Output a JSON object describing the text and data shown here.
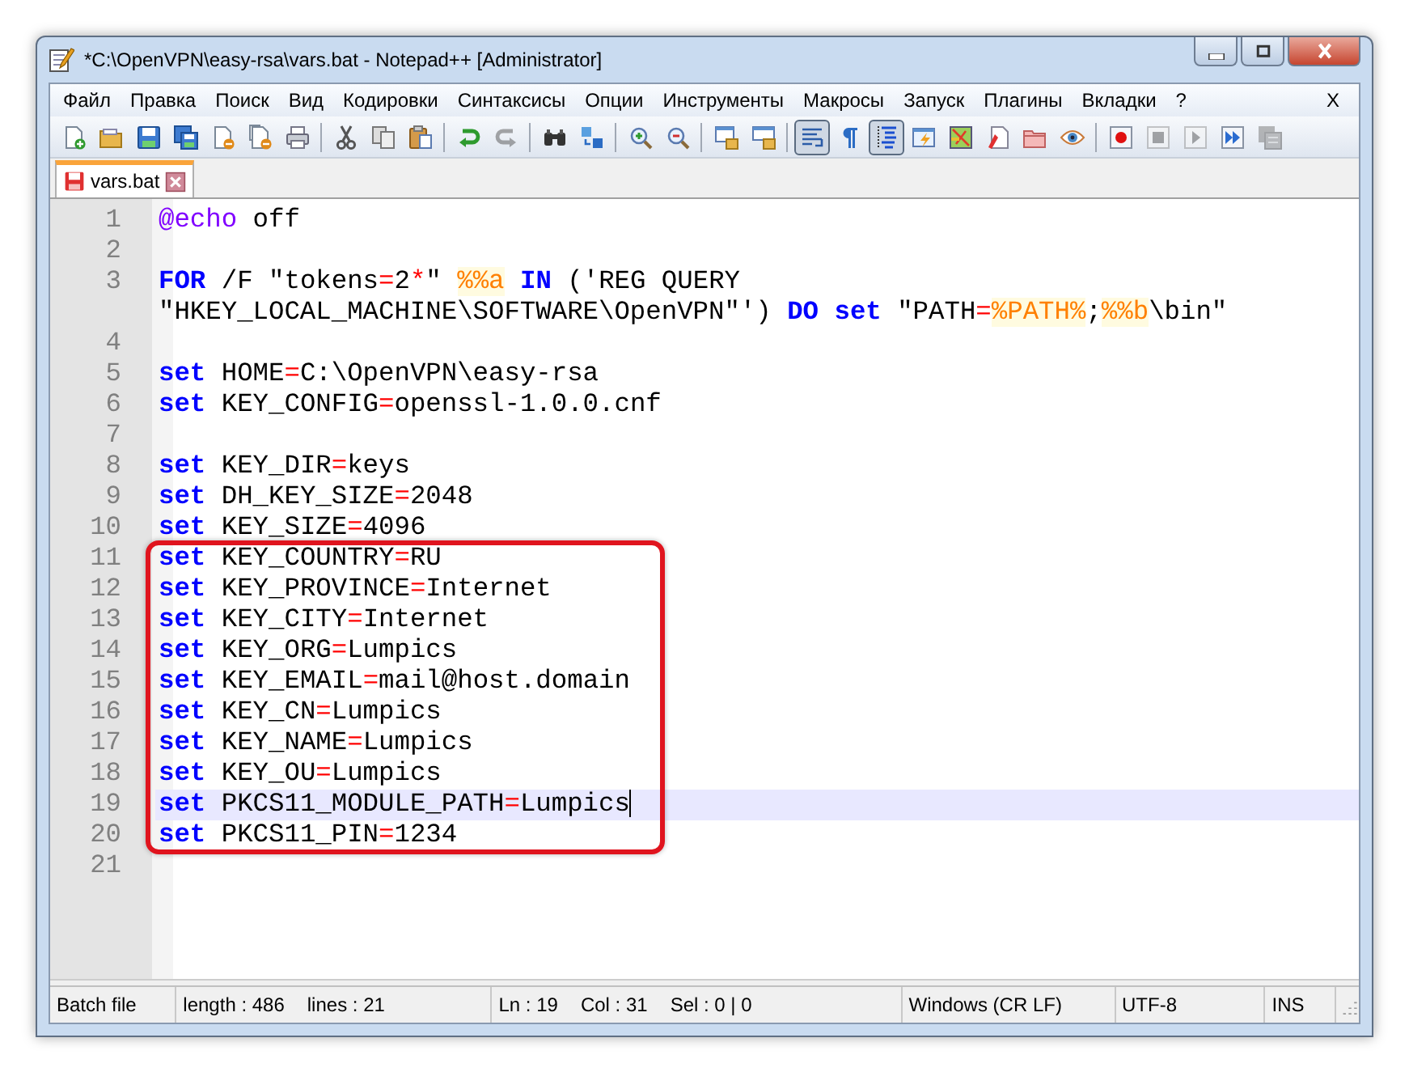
{
  "window": {
    "title": "*C:\\OpenVPN\\easy-rsa\\vars.bat - Notepad++ [Administrator]"
  },
  "menu": {
    "items": [
      "Файл",
      "Правка",
      "Поиск",
      "Вид",
      "Кодировки",
      "Синтаксисы",
      "Опции",
      "Инструменты",
      "Макросы",
      "Запуск",
      "Плагины",
      "Вкладки",
      "?"
    ],
    "close_label": "X"
  },
  "toolbar": [
    [
      {
        "kind": "new",
        "pressed": false,
        "disabled": false
      },
      {
        "kind": "open",
        "pressed": false,
        "disabled": false
      },
      {
        "kind": "save",
        "pressed": false,
        "disabled": false
      },
      {
        "kind": "save-all",
        "pressed": false,
        "disabled": false
      },
      {
        "kind": "close",
        "pressed": false,
        "disabled": false
      },
      {
        "kind": "close-all",
        "pressed": false,
        "disabled": false
      },
      {
        "kind": "print",
        "pressed": false,
        "disabled": false
      }
    ],
    [
      {
        "kind": "cut",
        "pressed": false,
        "disabled": false
      },
      {
        "kind": "copy",
        "pressed": false,
        "disabled": false
      },
      {
        "kind": "paste",
        "pressed": false,
        "disabled": false
      }
    ],
    [
      {
        "kind": "undo",
        "pressed": false,
        "disabled": false
      },
      {
        "kind": "redo",
        "pressed": false,
        "disabled": true
      }
    ],
    [
      {
        "kind": "find",
        "pressed": false,
        "disabled": false
      },
      {
        "kind": "replace",
        "pressed": false,
        "disabled": false
      }
    ],
    [
      {
        "kind": "zoom-in",
        "pressed": false,
        "disabled": false
      },
      {
        "kind": "zoom-out",
        "pressed": false,
        "disabled": false
      }
    ],
    [
      {
        "kind": "sync-v",
        "pressed": false,
        "disabled": false
      },
      {
        "kind": "sync-h",
        "pressed": false,
        "disabled": false
      }
    ],
    [
      {
        "kind": "wrap",
        "pressed": true,
        "disabled": false
      },
      {
        "kind": "show-all",
        "pressed": false,
        "disabled": false
      },
      {
        "kind": "indent-guide",
        "pressed": true,
        "disabled": false
      },
      {
        "kind": "udl",
        "pressed": false,
        "disabled": false
      },
      {
        "kind": "doc-map",
        "pressed": false,
        "disabled": false
      },
      {
        "kind": "func-list",
        "pressed": false,
        "disabled": false
      },
      {
        "kind": "folder",
        "pressed": false,
        "disabled": false
      },
      {
        "kind": "monitor",
        "pressed": false,
        "disabled": false
      }
    ],
    [
      {
        "kind": "record",
        "pressed": false,
        "disabled": false
      },
      {
        "kind": "stop",
        "pressed": false,
        "disabled": true
      },
      {
        "kind": "play",
        "pressed": false,
        "disabled": true
      },
      {
        "kind": "play-multi",
        "pressed": false,
        "disabled": false
      },
      {
        "kind": "save-macro",
        "pressed": false,
        "disabled": true
      }
    ]
  ],
  "tabs": [
    {
      "label": "vars.bat",
      "selected": true,
      "modified": true
    }
  ],
  "editor": {
    "sections": [
      {
        "outlined": false,
        "rows": [
          {
            "number": "1",
            "current": false,
            "tokens": [
              {
                "text": "@echo",
                "kind": "command"
              },
              {
                "text": " off",
                "kind": "text"
              }
            ]
          },
          {
            "number": "2",
            "current": false,
            "tokens": []
          },
          {
            "number": "3",
            "current": false,
            "tokens": [
              {
                "text": "FOR",
                "kind": "keyword"
              },
              {
                "text": " /F \"tokens",
                "kind": "text"
              },
              {
                "text": "=",
                "kind": "operator"
              },
              {
                "text": "2",
                "kind": "text"
              },
              {
                "text": "*",
                "kind": "operator"
              },
              {
                "text": "\" ",
                "kind": "text"
              },
              {
                "text": "%%a",
                "kind": "variable"
              },
              {
                "text": " IN",
                "kind": "keyword"
              },
              {
                "text": " ('REG QUERY",
                "kind": "text"
              }
            ]
          },
          {
            "current": false,
            "tokens": [
              {
                "text": "\"HKEY_LOCAL_MACHINE\\SOFTWARE\\OpenVPN\"') ",
                "kind": "text"
              },
              {
                "text": "DO",
                "kind": "keyword"
              },
              {
                "text": " set",
                "kind": "keyword"
              },
              {
                "text": " \"PATH",
                "kind": "text"
              },
              {
                "text": "=",
                "kind": "operator"
              },
              {
                "text": "%PATH%",
                "kind": "variable"
              },
              {
                "text": ";",
                "kind": "text"
              },
              {
                "text": "%%b",
                "kind": "variable"
              },
              {
                "text": "\\bin\"",
                "kind": "text"
              }
            ]
          },
          {
            "number": "4",
            "current": false,
            "tokens": []
          },
          {
            "number": "5",
            "current": false,
            "tokens": [
              {
                "text": "set",
                "kind": "keyword"
              },
              {
                "text": " HOME",
                "kind": "text"
              },
              {
                "text": "=",
                "kind": "operator"
              },
              {
                "text": "C:\\OpenVPN\\easy-rsa",
                "kind": "text"
              }
            ]
          },
          {
            "number": "6",
            "current": false,
            "tokens": [
              {
                "text": "set",
                "kind": "keyword"
              },
              {
                "text": " KEY_CONFIG",
                "kind": "text"
              },
              {
                "text": "=",
                "kind": "operator"
              },
              {
                "text": "openssl-1.0.0.cnf",
                "kind": "text"
              }
            ]
          },
          {
            "number": "7",
            "current": false,
            "tokens": []
          },
          {
            "number": "8",
            "current": false,
            "tokens": [
              {
                "text": "set",
                "kind": "keyword"
              },
              {
                "text": " KEY_DIR",
                "kind": "text"
              },
              {
                "text": "=",
                "kind": "operator"
              },
              {
                "text": "keys",
                "kind": "text"
              }
            ]
          },
          {
            "number": "9",
            "current": false,
            "tokens": [
              {
                "text": "set",
                "kind": "keyword"
              },
              {
                "text": " DH_KEY_SIZE",
                "kind": "text"
              },
              {
                "text": "=",
                "kind": "operator"
              },
              {
                "text": "2048",
                "kind": "text"
              }
            ]
          },
          {
            "number": "10",
            "current": false,
            "tokens": [
              {
                "text": "set",
                "kind": "keyword"
              },
              {
                "text": " KEY_SIZE",
                "kind": "text"
              },
              {
                "text": "=",
                "kind": "operator"
              },
              {
                "text": "4096",
                "kind": "text"
              }
            ]
          }
        ]
      },
      {
        "outlined": true,
        "rows": [
          {
            "number": "11",
            "current": false,
            "tokens": [
              {
                "text": "set",
                "kind": "keyword"
              },
              {
                "text": " KEY_COUNTRY",
                "kind": "text"
              },
              {
                "text": "=",
                "kind": "operator"
              },
              {
                "text": "RU",
                "kind": "text"
              }
            ]
          },
          {
            "number": "12",
            "current": false,
            "tokens": [
              {
                "text": "set",
                "kind": "keyword"
              },
              {
                "text": " KEY_PROVINCE",
                "kind": "text"
              },
              {
                "text": "=",
                "kind": "operator"
              },
              {
                "text": "Internet",
                "kind": "text"
              }
            ]
          },
          {
            "number": "13",
            "current": false,
            "tokens": [
              {
                "text": "set",
                "kind": "keyword"
              },
              {
                "text": " KEY_CITY",
                "kind": "text"
              },
              {
                "text": "=",
                "kind": "operator"
              },
              {
                "text": "Internet",
                "kind": "text"
              }
            ]
          },
          {
            "number": "14",
            "current": false,
            "tokens": [
              {
                "text": "set",
                "kind": "keyword"
              },
              {
                "text": " KEY_ORG",
                "kind": "text"
              },
              {
                "text": "=",
                "kind": "operator"
              },
              {
                "text": "Lumpics",
                "kind": "text"
              }
            ]
          },
          {
            "number": "15",
            "current": false,
            "tokens": [
              {
                "text": "set",
                "kind": "keyword"
              },
              {
                "text": " KEY_EMAIL",
                "kind": "text"
              },
              {
                "text": "=",
                "kind": "operator"
              },
              {
                "text": "mail@host.domain",
                "kind": "text"
              }
            ]
          },
          {
            "number": "16",
            "current": false,
            "tokens": [
              {
                "text": "set",
                "kind": "keyword"
              },
              {
                "text": " KEY_CN",
                "kind": "text"
              },
              {
                "text": "=",
                "kind": "operator"
              },
              {
                "text": "Lumpics",
                "kind": "text"
              }
            ]
          },
          {
            "number": "17",
            "current": false,
            "tokens": [
              {
                "text": "set",
                "kind": "keyword"
              },
              {
                "text": " KEY_NAME",
                "kind": "text"
              },
              {
                "text": "=",
                "kind": "operator"
              },
              {
                "text": "Lumpics",
                "kind": "text"
              }
            ]
          },
          {
            "number": "18",
            "current": false,
            "tokens": [
              {
                "text": "set",
                "kind": "keyword"
              },
              {
                "text": " KEY_OU",
                "kind": "text"
              },
              {
                "text": "=",
                "kind": "operator"
              },
              {
                "text": "Lumpics",
                "kind": "text"
              }
            ]
          },
          {
            "number": "19",
            "current": true,
            "tokens": [
              {
                "text": "set",
                "kind": "keyword"
              },
              {
                "text": " PKCS11_MODULE_PATH",
                "kind": "text"
              },
              {
                "text": "=",
                "kind": "operator"
              },
              {
                "text": "Lumpics",
                "kind": "text"
              }
            ]
          },
          {
            "number": "20",
            "current": false,
            "tokens": [
              {
                "text": "set",
                "kind": "keyword"
              },
              {
                "text": " PKCS11_PIN",
                "kind": "text"
              },
              {
                "text": "=",
                "kind": "operator"
              },
              {
                "text": "1234",
                "kind": "text"
              }
            ]
          }
        ]
      },
      {
        "outlined": false,
        "rows": [
          {
            "number": "21",
            "current": false,
            "tokens": []
          }
        ]
      }
    ]
  },
  "status_bar": [
    {
      "texts": [
        "Batch file"
      ]
    },
    {
      "texts": [
        "length : 486",
        "lines : 21"
      ]
    },
    {
      "texts": [
        "Ln : 19",
        "Col : 31",
        "Sel : 0 | 0"
      ]
    },
    {
      "texts": [
        "Windows (CR LF)"
      ]
    },
    {
      "texts": [
        "UTF-8"
      ]
    },
    {
      "texts": [
        "INS"
      ]
    }
  ]
}
